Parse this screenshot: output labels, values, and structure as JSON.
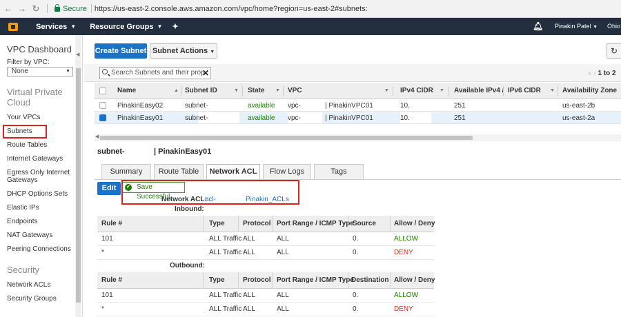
{
  "browser": {
    "secure_label": "Secure",
    "url": "https://us-east-2.console.aws.amazon.com/vpc/home?region=us-east-2#subnets:"
  },
  "topnav": {
    "services": "Services",
    "resource_groups": "Resource Groups",
    "user": "Pinakin Patel",
    "region": "Ohio"
  },
  "sidebar": {
    "title": "VPC Dashboard",
    "filter_label": "Filter by VPC:",
    "filter_value": "None",
    "section_vpc": "Virtual Private Cloud",
    "items": [
      "Your VPCs",
      "Subnets",
      "Route Tables",
      "Internet Gateways",
      "Egress Only Internet Gateways",
      "DHCP Options Sets",
      "Elastic IPs",
      "Endpoints",
      "NAT Gateways",
      "Peering Connections"
    ],
    "section_security": "Security",
    "security_items": [
      "Network ACLs",
      "Security Groups"
    ]
  },
  "toolbar": {
    "create_label": "Create Subnet",
    "actions_label": "Subnet Actions",
    "search_placeholder": "Search Subnets and their prop",
    "pager": "1 to 2"
  },
  "subnet_table": {
    "headers": [
      "Name",
      "Subnet ID",
      "State",
      "VPC",
      "IPv4 CIDR",
      "Available IPv4 /",
      "IPv6 CIDR",
      "Availability Zone"
    ],
    "rows": [
      {
        "name": "PinakinEasy02",
        "subnet_id": "subnet-",
        "state": "available",
        "vpc": "vpc-",
        "vpc_name": "| PinakinVPC01",
        "cidr": "10.",
        "available": "251",
        "ipv6": "",
        "az": "us-east-2b",
        "selected": false
      },
      {
        "name": "PinakinEasy01",
        "subnet_id": "subnet-",
        "state": "available",
        "vpc": "vpc-",
        "vpc_name": "| PinakinVPC01",
        "cidr": "10.",
        "available": "251",
        "ipv6": "",
        "az": "us-east-2a",
        "selected": true
      }
    ]
  },
  "detail": {
    "subnet_id": "subnet-",
    "subnet_name": "| PinakinEasy01",
    "tabs": [
      "Summary",
      "Route Table",
      "Network ACL",
      "Flow Logs",
      "Tags"
    ],
    "active_tab": "Network ACL",
    "edit_label": "Edit",
    "success_message": "Save Successful",
    "acl_label": "Network ACL:",
    "acl_id": "acl-",
    "acl_name": "Pinakin_ACLs",
    "inbound_label": "Inbound:",
    "outbound_label": "Outbound:",
    "inbound_headers": [
      "Rule #",
      "Type",
      "Protocol",
      "Port Range / ICMP Type",
      "Source",
      "Allow / Deny"
    ],
    "outbound_headers": [
      "Rule #",
      "Type",
      "Protocol",
      "Port Range / ICMP Type",
      "Destination",
      "Allow / Deny"
    ],
    "inbound_rows": [
      {
        "rule": "101",
        "type": "ALL Traffic",
        "protocol": "ALL",
        "ports": "ALL",
        "cidr": "0.",
        "action": "ALLOW"
      },
      {
        "rule": "*",
        "type": "ALL Traffic",
        "protocol": "ALL",
        "ports": "ALL",
        "cidr": "0.",
        "action": "DENY"
      }
    ],
    "outbound_rows": [
      {
        "rule": "101",
        "type": "ALL Traffic",
        "protocol": "ALL",
        "ports": "ALL",
        "cidr": "0.",
        "action": "ALLOW"
      },
      {
        "rule": "*",
        "type": "ALL Traffic",
        "protocol": "ALL",
        "ports": "ALL",
        "cidr": "0.",
        "action": "DENY"
      }
    ]
  },
  "colors": {
    "aws_nav": "#232f3e",
    "primary_blue": "#1a73c7",
    "available_green": "#1d8102",
    "deny_red": "#d13212",
    "highlight_red": "#e02020"
  }
}
